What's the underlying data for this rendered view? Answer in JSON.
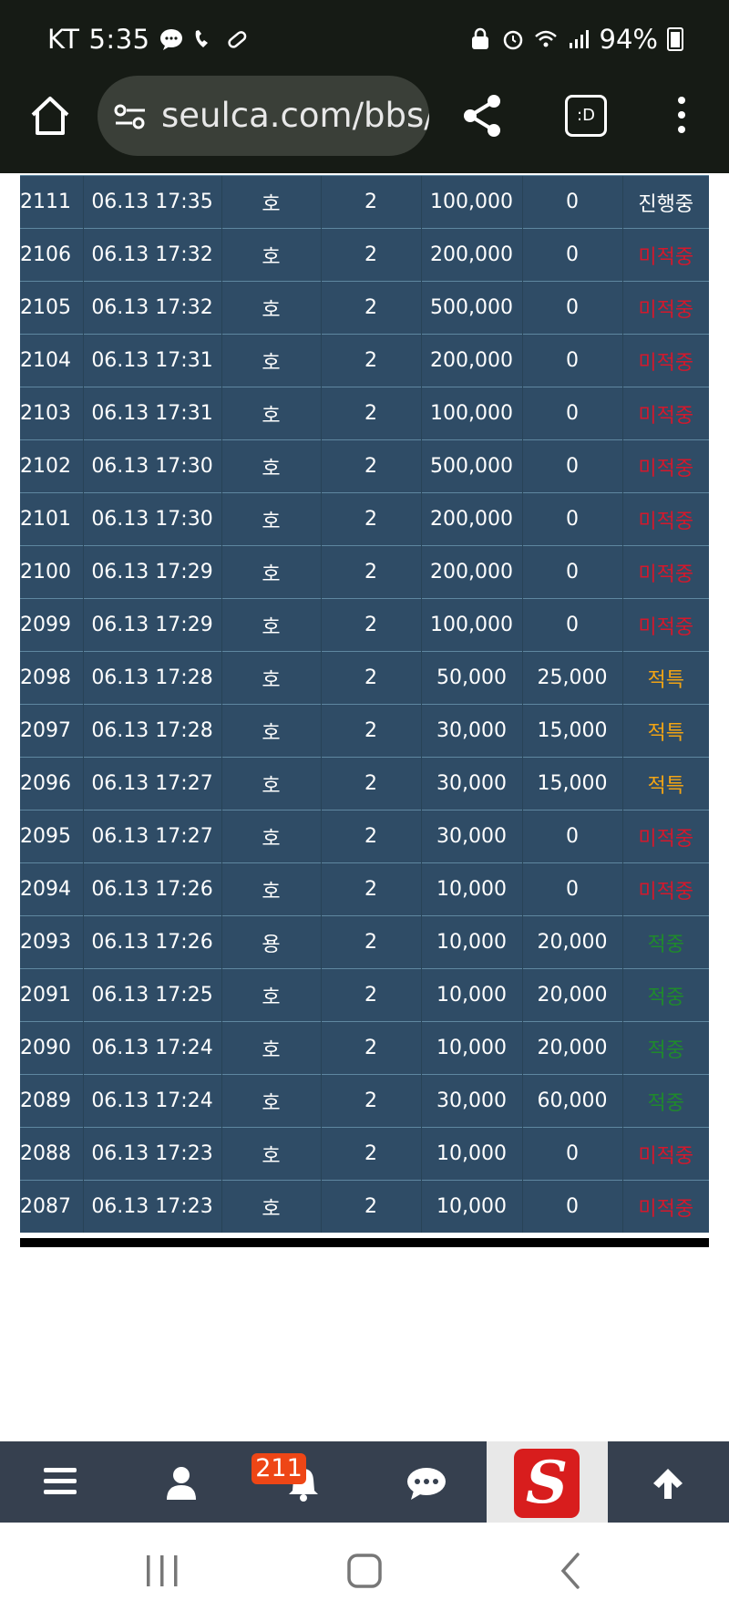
{
  "status_bar": {
    "carrier": "KT",
    "time": "5:35",
    "battery": "94%"
  },
  "browser": {
    "url": "seulca.com/bbs/",
    "tabs_label": ":D"
  },
  "table": {
    "rows": [
      {
        "no": "2111",
        "datetime": "06.13 17:35",
        "pick": "호",
        "count": "2",
        "bet": "100,000",
        "win": "0",
        "status": "진행중",
        "status_color": "#ffffff"
      },
      {
        "no": "2106",
        "datetime": "06.13 17:32",
        "pick": "호",
        "count": "2",
        "bet": "200,000",
        "win": "0",
        "status": "미적중",
        "status_color": "#d4182c"
      },
      {
        "no": "2105",
        "datetime": "06.13 17:32",
        "pick": "호",
        "count": "2",
        "bet": "500,000",
        "win": "0",
        "status": "미적중",
        "status_color": "#d4182c"
      },
      {
        "no": "2104",
        "datetime": "06.13 17:31",
        "pick": "호",
        "count": "2",
        "bet": "200,000",
        "win": "0",
        "status": "미적중",
        "status_color": "#d4182c"
      },
      {
        "no": "2103",
        "datetime": "06.13 17:31",
        "pick": "호",
        "count": "2",
        "bet": "100,000",
        "win": "0",
        "status": "미적중",
        "status_color": "#d4182c"
      },
      {
        "no": "2102",
        "datetime": "06.13 17:30",
        "pick": "호",
        "count": "2",
        "bet": "500,000",
        "win": "0",
        "status": "미적중",
        "status_color": "#d4182c"
      },
      {
        "no": "2101",
        "datetime": "06.13 17:30",
        "pick": "호",
        "count": "2",
        "bet": "200,000",
        "win": "0",
        "status": "미적중",
        "status_color": "#d4182c"
      },
      {
        "no": "2100",
        "datetime": "06.13 17:29",
        "pick": "호",
        "count": "2",
        "bet": "200,000",
        "win": "0",
        "status": "미적중",
        "status_color": "#d4182c"
      },
      {
        "no": "2099",
        "datetime": "06.13 17:29",
        "pick": "호",
        "count": "2",
        "bet": "100,000",
        "win": "0",
        "status": "미적중",
        "status_color": "#d4182c"
      },
      {
        "no": "2098",
        "datetime": "06.13 17:28",
        "pick": "호",
        "count": "2",
        "bet": "50,000",
        "win": "25,000",
        "status": "적특",
        "status_color": "#f2a414"
      },
      {
        "no": "2097",
        "datetime": "06.13 17:28",
        "pick": "호",
        "count": "2",
        "bet": "30,000",
        "win": "15,000",
        "status": "적특",
        "status_color": "#f2a414"
      },
      {
        "no": "2096",
        "datetime": "06.13 17:27",
        "pick": "호",
        "count": "2",
        "bet": "30,000",
        "win": "15,000",
        "status": "적특",
        "status_color": "#f2a414"
      },
      {
        "no": "2095",
        "datetime": "06.13 17:27",
        "pick": "호",
        "count": "2",
        "bet": "30,000",
        "win": "0",
        "status": "미적중",
        "status_color": "#d4182c"
      },
      {
        "no": "2094",
        "datetime": "06.13 17:26",
        "pick": "호",
        "count": "2",
        "bet": "10,000",
        "win": "0",
        "status": "미적중",
        "status_color": "#d4182c"
      },
      {
        "no": "2093",
        "datetime": "06.13 17:26",
        "pick": "용",
        "count": "2",
        "bet": "10,000",
        "win": "20,000",
        "status": "적중",
        "status_color": "#1f8a2c"
      },
      {
        "no": "2091",
        "datetime": "06.13 17:25",
        "pick": "호",
        "count": "2",
        "bet": "10,000",
        "win": "20,000",
        "status": "적중",
        "status_color": "#1f8a2c"
      },
      {
        "no": "2090",
        "datetime": "06.13 17:24",
        "pick": "호",
        "count": "2",
        "bet": "10,000",
        "win": "20,000",
        "status": "적중",
        "status_color": "#1f8a2c"
      },
      {
        "no": "2089",
        "datetime": "06.13 17:24",
        "pick": "호",
        "count": "2",
        "bet": "30,000",
        "win": "60,000",
        "status": "적중",
        "status_color": "#1f8a2c"
      },
      {
        "no": "2088",
        "datetime": "06.13 17:23",
        "pick": "호",
        "count": "2",
        "bet": "10,000",
        "win": "0",
        "status": "미적중",
        "status_color": "#d4182c"
      },
      {
        "no": "2087",
        "datetime": "06.13 17:23",
        "pick": "호",
        "count": "2",
        "bet": "10,000",
        "win": "0",
        "status": "미적중",
        "status_color": "#d4182c"
      }
    ]
  },
  "site_nav": {
    "notification_count": "211",
    "logo_letter": "S",
    "icons": [
      "menu-icon",
      "user-icon",
      "bell-icon",
      "chat-icon",
      "site-logo",
      "arrow-up-icon"
    ]
  },
  "colors": {
    "table_bg": "#2f4c66",
    "nav_bg": "#36404f",
    "badge_bg": "#ee4616"
  }
}
